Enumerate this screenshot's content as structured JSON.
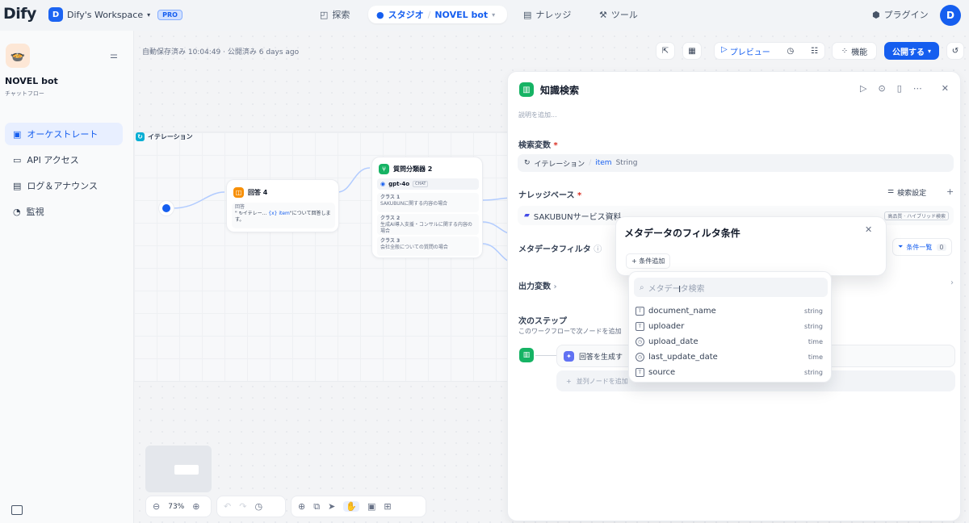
{
  "topbar": {
    "logo": "Dify",
    "workspace_initial": "D",
    "workspace_name": "Dify's Workspace",
    "plan_badge": "PRO",
    "nav_explore": "探索",
    "nav_studio": "スタジオ",
    "nav_app": "NOVEL bot",
    "nav_knowledge": "ナレッジ",
    "nav_tools": "ツール",
    "plugins": "プラグイン",
    "user_initial": "D"
  },
  "sidebar": {
    "app_name": "NOVEL bot",
    "app_type": "チャットフロー",
    "items": [
      {
        "label": "オーケストレート",
        "icon": "layout-icon"
      },
      {
        "label": "API アクセス",
        "icon": "terminal-icon"
      },
      {
        "label": "ログ＆アナウンス",
        "icon": "file-icon"
      },
      {
        "label": "監視",
        "icon": "monitor-icon"
      }
    ]
  },
  "canvas": {
    "autosave": "自動保存済み 10:04:49 · 公開済み 6 days ago",
    "preview": "プレビュー",
    "features": "機能",
    "publish": "公開する",
    "iteration_label": "イテレーション",
    "zoom": "73%"
  },
  "nodes": {
    "answer": {
      "title": "回答 4",
      "sub": "回答",
      "content_prefix": "\"",
      "content_var": "イテレー...",
      "content_item": "{x} item",
      "content_suffix": "\"について回答します。"
    },
    "classifier": {
      "title": "質問分類器 2",
      "model": "gpt-4o",
      "model_tag": "CHAT",
      "classes": [
        {
          "name": "クラス 1",
          "desc": "SAKUBUNに関する内容の場合"
        },
        {
          "name": "クラス 2",
          "desc": "生成AI導入支援・コンサルに関する内容の場合"
        },
        {
          "name": "クラス 3",
          "desc": "会社全般についての質問の場合"
        }
      ]
    }
  },
  "panel": {
    "title": "知識検索",
    "desc_placeholder": "説明を追加...",
    "query_var_label": "検索変数",
    "query_var_src": "イテレーション",
    "query_var_name": "item",
    "query_var_type": "String",
    "knowledge_label": "ナレッジベース",
    "retrieval_settings": "検索設定",
    "kb_name": "SAKUBUNサービス資料",
    "kb_meta": "高品質 · ハイブリッド検索",
    "metadata_filter_label": "メタデータフィルタ",
    "conditions_list": "条件一覧",
    "conditions_count": "0",
    "output_var_label": "出力変数",
    "next_step_label": "次のステップ",
    "next_step_desc": "このワークフローで次ノードを追加",
    "next_node": "回答を生成す",
    "add_parallel": "並列ノードを追加"
  },
  "filter_popover": {
    "title": "メタデータのフィルタ条件",
    "add_condition": "+ 条件追加"
  },
  "metadata_dropdown": {
    "search_placeholder": "メタデータ検索",
    "items": [
      {
        "name": "document_name",
        "type": "string",
        "icon": "text-type-icon"
      },
      {
        "name": "uploader",
        "type": "string",
        "icon": "text-type-icon"
      },
      {
        "name": "upload_date",
        "type": "time",
        "icon": "clock-icon"
      },
      {
        "name": "last_update_date",
        "type": "time",
        "icon": "clock-icon"
      },
      {
        "name": "source",
        "type": "string",
        "icon": "text-type-icon"
      }
    ]
  },
  "colors": {
    "accent": "#155eef",
    "knowledge_green": "#16b364",
    "answer_orange": "#f79009"
  }
}
